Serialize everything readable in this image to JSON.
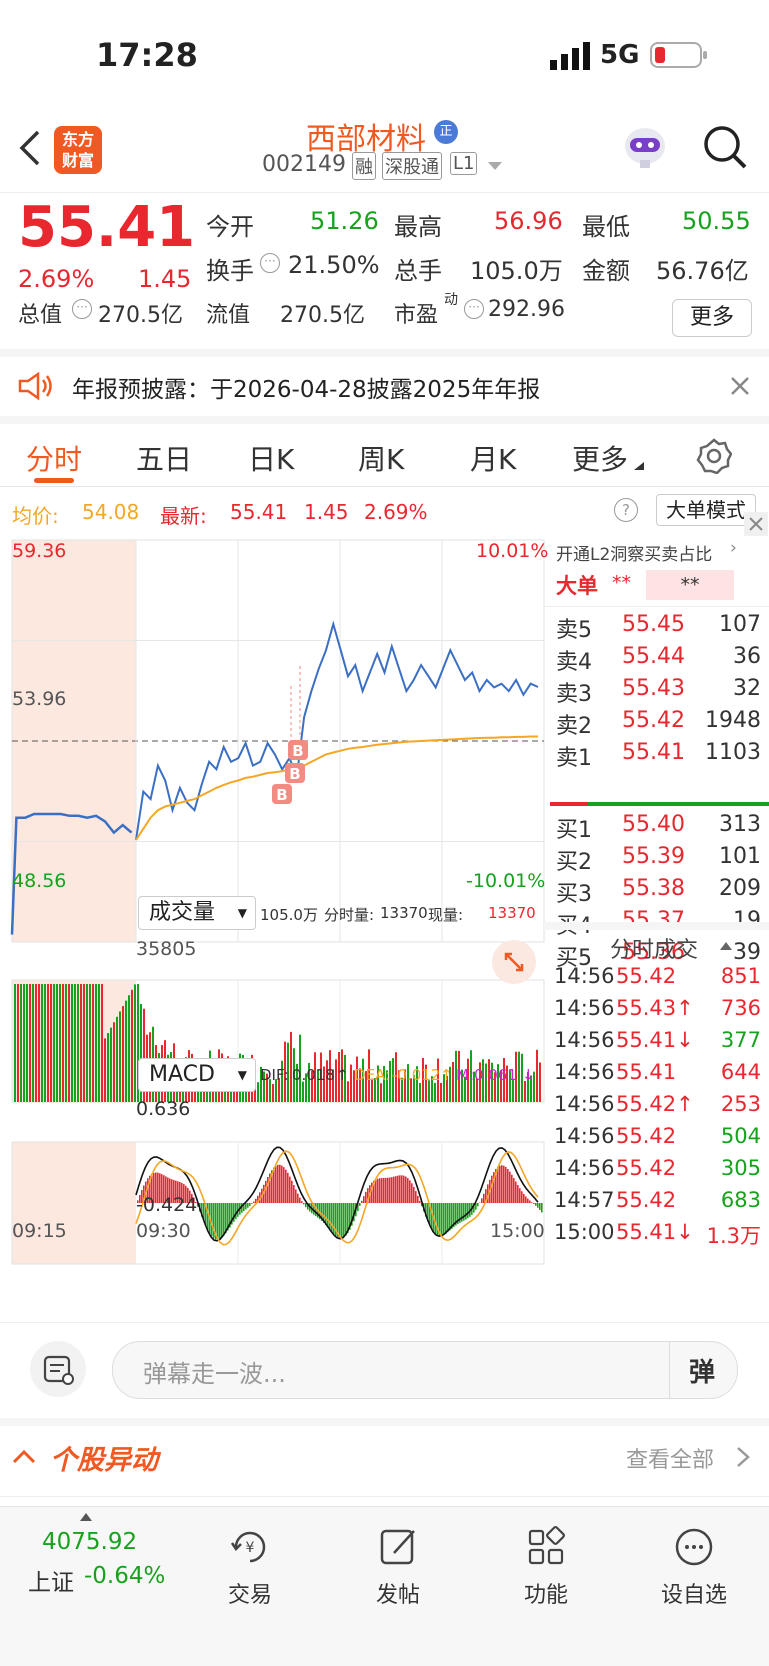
{
  "status": {
    "time": "17:28",
    "network": "5G"
  },
  "header": {
    "logo_line1": "东方",
    "logo_line2": "财富",
    "stock_name": "西部材料",
    "name_badge": "正",
    "code": "002149",
    "tags": [
      "融",
      "深股通",
      "L1"
    ]
  },
  "quote": {
    "price": "55.41",
    "change_pct": "2.69%",
    "change": "1.45",
    "open_label": "今开",
    "open": "51.26",
    "high_label": "最高",
    "high": "56.96",
    "low_label": "最低",
    "low": "50.55",
    "turnover_label": "换手",
    "turnover": "21.50%",
    "volume_label": "总手",
    "volume": "105.0万",
    "amount_label": "金额",
    "amount": "56.76亿",
    "mktcap_label": "总值",
    "mktcap": "270.5亿",
    "float_label": "流值",
    "float": "270.5亿",
    "pe_label": "市盈",
    "pe_sup": "动",
    "pe": "292.96",
    "more_button": "更多"
  },
  "notice": {
    "text": "年报预披露：于2026-04-28披露2025年年报"
  },
  "tabs": [
    "分时",
    "五日",
    "日K",
    "周K",
    "月K",
    "更多"
  ],
  "chart_info": {
    "avg_label": "均价:",
    "avg": "54.08",
    "latest_label": "最新:",
    "latest": "55.41",
    "latest_change": "1.45",
    "latest_pct": "2.69%",
    "mode_button": "大单模式"
  },
  "chart_data": {
    "type": "line",
    "y_top": "59.36",
    "y_mid": "53.96",
    "y_bottom": "48.56",
    "pct_top": "10.01%",
    "pct_bottom": "-10.01%",
    "ylim": [
      48.56,
      59.36
    ],
    "time_labels": [
      "09:15",
      "09:30",
      "15:00"
    ],
    "series": [
      {
        "name": "最新",
        "color": "#3b6fc4",
        "values": [
          51.3,
          52.6,
          52.4,
          53.3,
          52.9,
          52.1,
          52.7,
          52.3,
          52.1,
          52.8,
          53.4,
          53.2,
          53.8,
          53.4,
          53.5,
          53.9,
          53.3,
          53.4,
          53.9,
          53.6,
          53.2,
          53.5,
          53.0,
          54.6,
          55.3,
          55.9,
          56.4,
          57.1,
          56.4,
          55.7,
          56.0,
          55.3,
          55.8,
          56.3,
          55.8,
          56.5,
          55.9,
          55.3,
          55.6,
          56.0,
          55.7,
          55.4,
          55.9,
          56.4,
          56.0,
          55.6,
          55.8,
          55.3,
          55.6,
          55.4,
          55.5,
          55.3,
          55.6,
          55.2,
          55.5,
          55.41
        ]
      },
      {
        "name": "均价",
        "color": "#f5a623",
        "values": [
          51.3,
          51.6,
          51.9,
          52.1,
          52.2,
          52.25,
          52.3,
          52.35,
          52.4,
          52.5,
          52.6,
          52.7,
          52.78,
          52.85,
          52.9,
          52.97,
          53.0,
          53.05,
          53.1,
          53.12,
          53.15,
          53.2,
          53.22,
          53.3,
          53.4,
          53.5,
          53.6,
          53.65,
          53.7,
          53.75,
          53.78,
          53.8,
          53.83,
          53.86,
          53.88,
          53.9,
          53.92,
          53.94,
          53.95,
          53.96,
          53.97,
          53.98,
          53.99,
          54.0,
          54.01,
          54.02,
          54.03,
          54.04,
          54.05,
          54.05,
          54.06,
          54.06,
          54.07,
          54.07,
          54.08,
          54.08
        ]
      }
    ],
    "auction_values": [
      51.9,
      51.9,
      52.0,
      52.0,
      52.0,
      52.0,
      51.95,
      51.95,
      51.9,
      51.95,
      51.8,
      51.5,
      51.7,
      51.5
    ],
    "volume_label": "成交量",
    "volume_total": "105.0万",
    "tick_vol_label": "分时量:",
    "tick_vol": "13370",
    "now_vol_label": "现量:",
    "now_vol": "13370",
    "volume_max": "35805",
    "macd_label": "MACD",
    "dif_label": "DIF:",
    "dif": "0.018",
    "dea_label": "DEA:",
    "dea": "-0.012",
    "m_label": "M:",
    "m": "0.061",
    "macd_top": "0.636",
    "macd_bottom": "-0.424"
  },
  "order_book": {
    "promo": "开通L2洞察买卖占比",
    "big_label": "大单",
    "big_value": "**",
    "big_value2": "**",
    "asks": [
      {
        "label": "卖5",
        "price": "55.45",
        "vol": "107"
      },
      {
        "label": "卖4",
        "price": "55.44",
        "vol": "36"
      },
      {
        "label": "卖3",
        "price": "55.43",
        "vol": "32"
      },
      {
        "label": "卖2",
        "price": "55.42",
        "vol": "1948"
      },
      {
        "label": "卖1",
        "price": "55.41",
        "vol": "1103"
      }
    ],
    "bids": [
      {
        "label": "买1",
        "price": "55.40",
        "vol": "313"
      },
      {
        "label": "买2",
        "price": "55.39",
        "vol": "101"
      },
      {
        "label": "买3",
        "price": "55.38",
        "vol": "209"
      },
      {
        "label": "买4",
        "price": "55.37",
        "vol": "19"
      },
      {
        "label": "买5",
        "price": "55.36",
        "vol": "39"
      }
    ]
  },
  "ticks": {
    "title": "分时成交",
    "rows": [
      {
        "time": "14:56",
        "price": "55.42",
        "vol": "851"
      },
      {
        "time": "14:56",
        "price": "55.43↑",
        "vol": "736"
      },
      {
        "time": "14:56",
        "price": "55.41↓",
        "vol": "377"
      },
      {
        "time": "14:56",
        "price": "55.41",
        "vol": "644"
      },
      {
        "time": "14:56",
        "price": "55.42↑",
        "vol": "253"
      },
      {
        "time": "14:56",
        "price": "55.42",
        "vol": "504"
      },
      {
        "time": "14:56",
        "price": "55.42",
        "vol": "305"
      },
      {
        "time": "14:57",
        "price": "55.42",
        "vol": "683"
      },
      {
        "time": "15:00",
        "price": "55.41↓",
        "vol": "1.3万"
      }
    ]
  },
  "comment": {
    "placeholder": "弹幕走一波...",
    "danmu_icon": "弹"
  },
  "movement": {
    "title": "个股异动",
    "view_all": "查看全部"
  },
  "bottom_nav": {
    "index_value": "4075.92",
    "index_label": "上证",
    "index_pct": "-0.64%",
    "items": [
      {
        "label": "交易",
        "icon": "trade-icon"
      },
      {
        "label": "发帖",
        "icon": "post-icon"
      },
      {
        "label": "功能",
        "icon": "apps-icon"
      },
      {
        "label": "设自选",
        "icon": "watchlist-icon"
      }
    ]
  }
}
